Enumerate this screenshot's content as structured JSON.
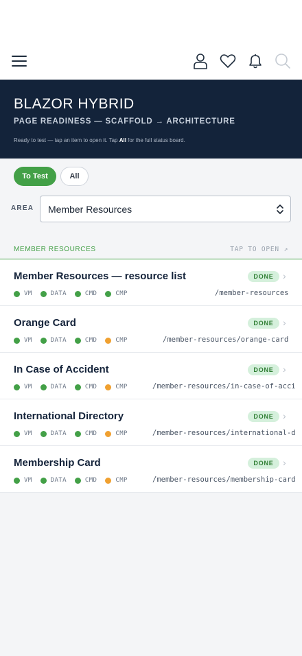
{
  "header": {
    "menu_icon": "hamburger-menu-icon",
    "icons": [
      "user-icon",
      "heart-icon",
      "bell-icon",
      "search-icon"
    ]
  },
  "hero": {
    "title": "BLAZOR HYBRID",
    "subtitle": "PAGE READINESS — SCAFFOLD → ARCHITECTURE",
    "hint_prefix": "Ready to test — tap an item to open it. Tap ",
    "hint_bold": "All",
    "hint_suffix": " for the full status board.",
    "background": "#13233a"
  },
  "filters": {
    "to_test_label": "To Test",
    "all_label": "All",
    "active_color": "#43a047"
  },
  "area": {
    "label": "AREA",
    "selected": "Member Resources"
  },
  "section": {
    "title": "MEMBER RESOURCES",
    "hint": "TAP TO OPEN ↗"
  },
  "status_colors": {
    "green": "#43a047",
    "orange": "#f0a030"
  },
  "items": [
    {
      "title": "Member Resources — resource list",
      "status": "DONE",
      "path": "/member-resources",
      "tags": [
        {
          "label": "VM",
          "color": "#43a047"
        },
        {
          "label": "DATA",
          "color": "#43a047"
        },
        {
          "label": "CMD",
          "color": "#43a047"
        },
        {
          "label": "CMP",
          "color": "#43a047"
        }
      ]
    },
    {
      "title": "Orange Card",
      "status": "DONE",
      "path": "/member-resources/orange-card",
      "tags": [
        {
          "label": "VM",
          "color": "#43a047"
        },
        {
          "label": "DATA",
          "color": "#43a047"
        },
        {
          "label": "CMD",
          "color": "#43a047"
        },
        {
          "label": "CMP",
          "color": "#f0a030"
        }
      ]
    },
    {
      "title": "In Case of Accident",
      "status": "DONE",
      "path": "/member-resources/in-case-of-acci",
      "tags": [
        {
          "label": "VM",
          "color": "#43a047"
        },
        {
          "label": "DATA",
          "color": "#43a047"
        },
        {
          "label": "CMD",
          "color": "#43a047"
        },
        {
          "label": "CMP",
          "color": "#f0a030"
        }
      ]
    },
    {
      "title": "International Directory",
      "status": "DONE",
      "path": "/member-resources/international-d",
      "tags": [
        {
          "label": "VM",
          "color": "#43a047"
        },
        {
          "label": "DATA",
          "color": "#43a047"
        },
        {
          "label": "CMD",
          "color": "#43a047"
        },
        {
          "label": "CMP",
          "color": "#f0a030"
        }
      ]
    },
    {
      "title": "Membership Card",
      "status": "DONE",
      "path": "/member-resources/membership-card",
      "tags": [
        {
          "label": "VM",
          "color": "#43a047"
        },
        {
          "label": "DATA",
          "color": "#43a047"
        },
        {
          "label": "CMD",
          "color": "#43a047"
        },
        {
          "label": "CMP",
          "color": "#f0a030"
        }
      ]
    }
  ]
}
